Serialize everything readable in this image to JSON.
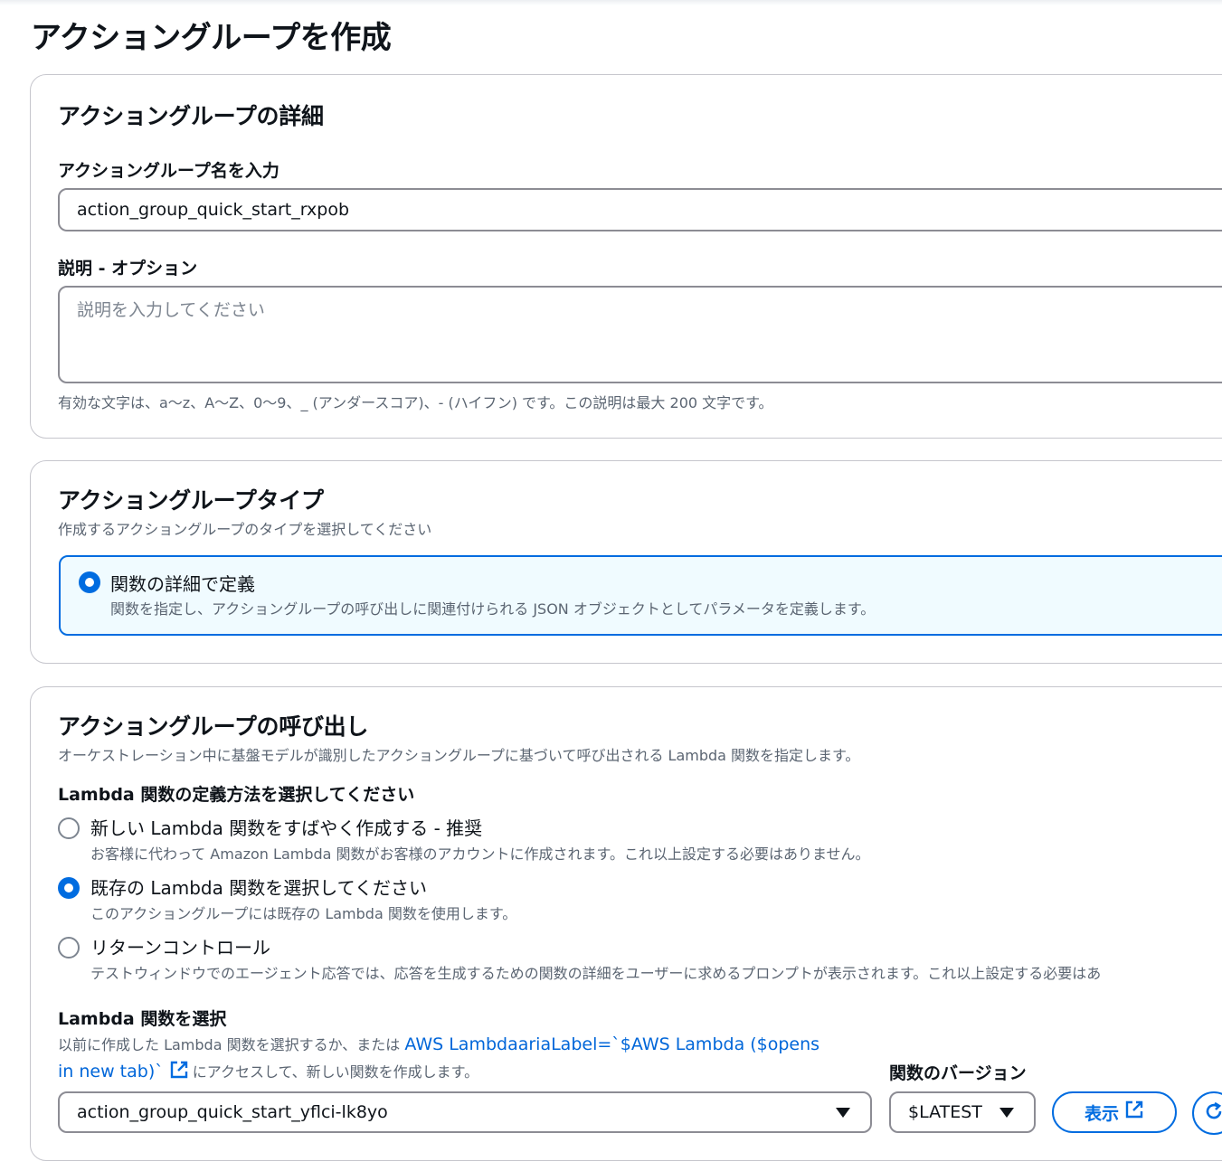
{
  "page": {
    "title": "アクショングループを作成"
  },
  "details": {
    "heading": "アクショングループの詳細",
    "name_label": "アクショングループ名を入力",
    "name_value": "action_group_quick_start_rxpob",
    "desc_label": "説明 - オプション",
    "desc_placeholder": "説明を入力してください",
    "desc_hint": "有効な文字は、a～z、A～Z、0～9、_ (アンダースコア)、- (ハイフン) です。この説明は最大 200 文字です。"
  },
  "type": {
    "heading": "アクショングループタイプ",
    "subheading": "作成するアクショングループのタイプを選択してください",
    "option_label": "関数の詳細で定義",
    "option_desc": "関数を指定し、アクショングループの呼び出しに関連付けられる JSON オブジェクトとしてパラメータを定義します。"
  },
  "invocation": {
    "heading": "アクショングループの呼び出し",
    "subheading": "オーケストレーション中に基盤モデルが識別したアクショングループに基づいて呼び出される Lambda 関数を指定します。",
    "method_label": "Lambda 関数の定義方法を選択してください",
    "options": [
      {
        "label": "新しい Lambda 関数をすばやく作成する - 推奨",
        "desc": "お客様に代わって Amazon Lambda 関数がお客様のアカウントに作成されます。これ以上設定する必要はありません。",
        "selected": false
      },
      {
        "label": "既存の Lambda 関数を選択してください",
        "desc": "このアクショングループには既存の Lambda 関数を使用します。",
        "selected": true
      },
      {
        "label": "リターンコントロール",
        "desc": "テストウィンドウでのエージェント応答では、応答を生成するための関数の詳細をユーザーに求めるプロンプトが表示されます。これ以上設定する必要はあ",
        "selected": false
      }
    ],
    "select_label": "Lambda 関数を選択",
    "select_hint_pre": "以前に作成した Lambda 関数を選択するか、または ",
    "select_hint_link1": "AWS LambdaariaLabel=`$AWS Lambda ($opens",
    "select_hint_link2": "in new tab)`",
    "select_hint_post": "にアクセスして、新しい関数を作成します。",
    "function_value": "action_group_quick_start_yflci-lk8yo",
    "version_label": "関数のバージョン",
    "version_value": "$LATEST",
    "view_button": "表示"
  },
  "colors": {
    "accent": "#006ce0",
    "link": "#0066d9",
    "tile_bg": "#f0fbff"
  },
  "icons": [
    "external-link-icon",
    "caret-down-icon",
    "refresh-icon",
    "radio-icon"
  ]
}
